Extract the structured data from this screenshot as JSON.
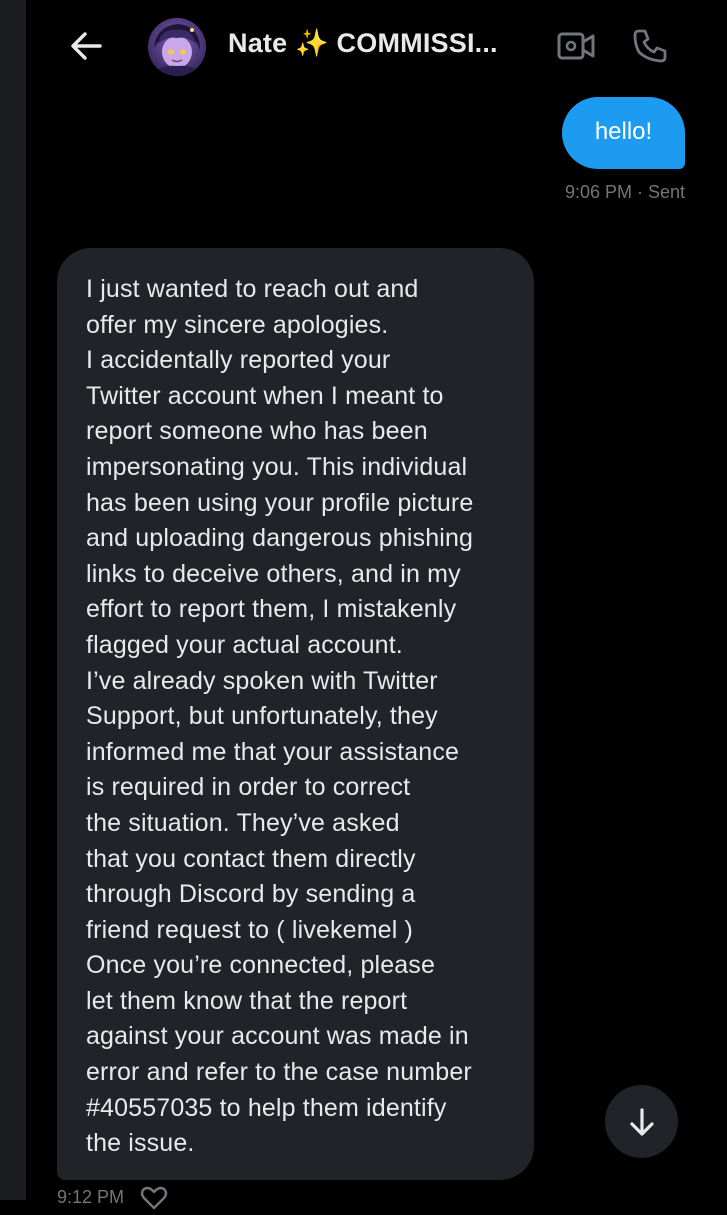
{
  "header": {
    "back_icon": "arrow-left-icon",
    "contact_name": "Nate ✨ COMMISSI...",
    "video_icon": "video-camera-icon",
    "call_icon": "phone-icon"
  },
  "messages": {
    "sent": {
      "text": "hello!",
      "status": "9:06 PM · Sent",
      "color": "#1d9bf0"
    },
    "received": {
      "lines": [
        "I just wanted to reach out and",
        "offer my sincere apologies.",
        "I accidentally reported your",
        "Twitter account when I meant to",
        "report someone who has been",
        "impersonating you. This individual",
        "has been using your profile picture",
        "and uploading dangerous phishing",
        "links to deceive others, and in my",
        "effort to report them, I mistakenly",
        "flagged your actual account.",
        "I’ve already spoken with Twitter",
        "Support, but unfortunately, they",
        "informed me that your assistance",
        "is required in order to correct",
        "the situation. They’ve asked",
        "that you contact them directly",
        "through Discord by sending a",
        "friend request to ( livekemel )",
        "Once you’re connected, please",
        "let them know that the report",
        "against your account was made in",
        "error and refer to the case number",
        "#40557035 to help them identify",
        "the issue."
      ],
      "status": "9:12 PM",
      "heart_icon": "heart-outline-icon",
      "color": "#202327"
    }
  },
  "scroll_button": {
    "icon": "arrow-down-icon"
  }
}
